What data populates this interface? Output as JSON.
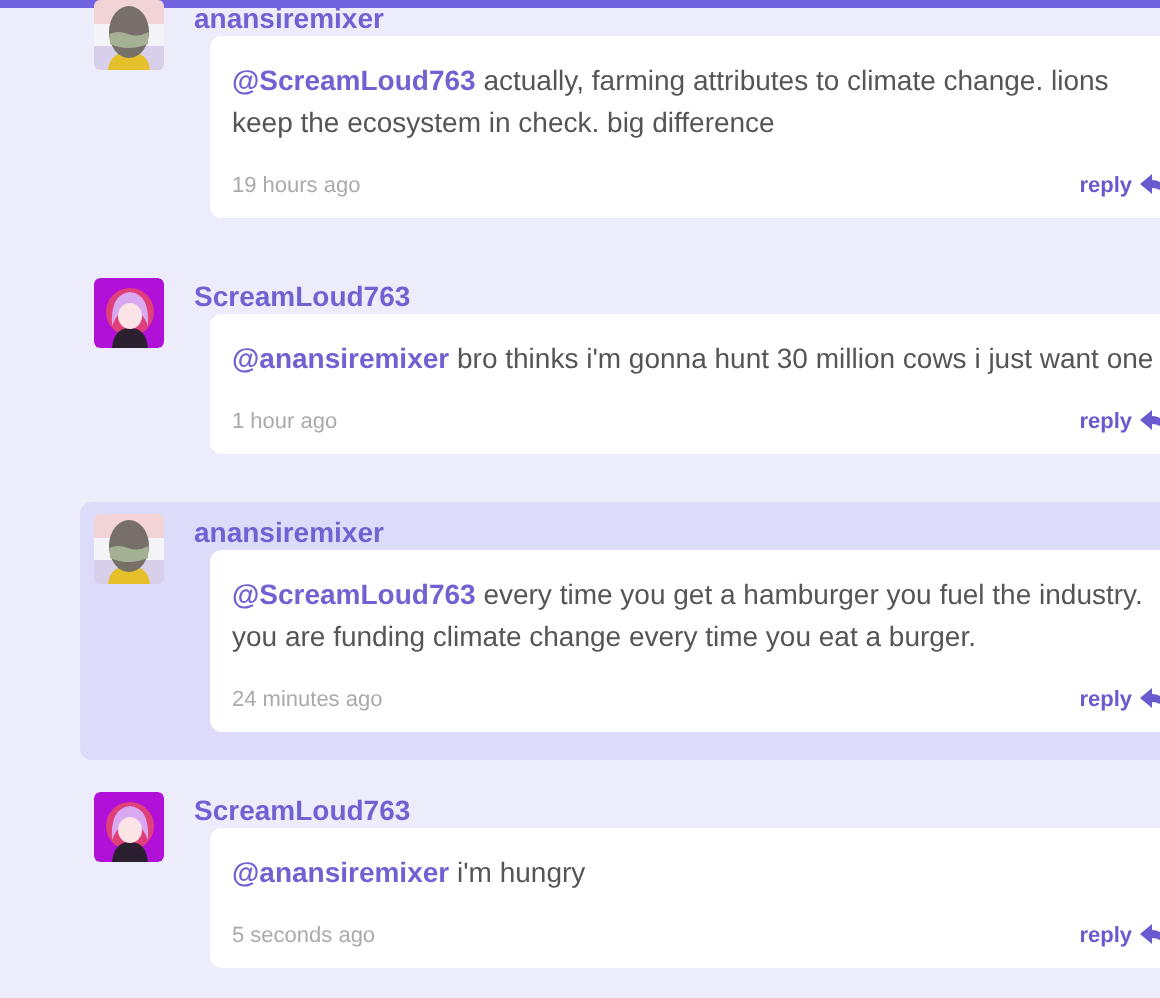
{
  "comments": [
    {
      "username": "anansiremixer",
      "avatar": {
        "kind": "grey-figure"
      },
      "mention": "@ScreamLoud763",
      "text": "actually, farming attributes to climate change. lions keep the ecosystem in check. big difference",
      "time": "19 hours ago",
      "reply": "reply",
      "selected": false
    },
    {
      "username": "ScreamLoud763",
      "avatar": {
        "kind": "pink-haired-figure"
      },
      "mention": "@anansiremixer",
      "text": "bro thinks i'm gonna hunt 30 million cows i just want one",
      "time": "1 hour ago",
      "reply": "reply",
      "selected": false
    },
    {
      "username": "anansiremixer",
      "avatar": {
        "kind": "grey-figure"
      },
      "mention": "@ScreamLoud763",
      "text": "every time you get a hamburger you fuel the industry. you are funding climate change every time you eat a burger.",
      "time": "24 minutes ago",
      "reply": "reply",
      "selected": true
    },
    {
      "username": "ScreamLoud763",
      "avatar": {
        "kind": "pink-haired-figure"
      },
      "mention": "@anansiremixer",
      "text": "i'm hungry",
      "time": "5 seconds ago",
      "reply": "reply",
      "selected": false
    }
  ]
}
